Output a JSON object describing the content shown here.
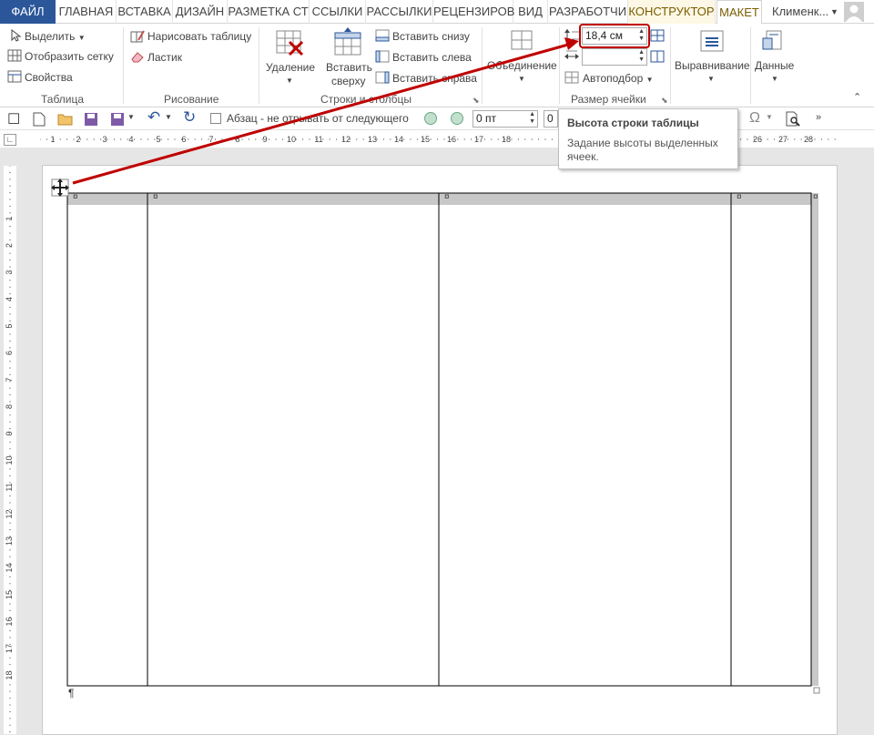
{
  "tabs": [
    {
      "label": "ФАЙЛ",
      "key": "file"
    },
    {
      "label": "ГЛАВНАЯ"
    },
    {
      "label": "ВСТАВКА"
    },
    {
      "label": "ДИЗАЙН"
    },
    {
      "label": "РАЗМЕТКА СТ"
    },
    {
      "label": "ССЫЛКИ"
    },
    {
      "label": "РАССЫЛКИ"
    },
    {
      "label": "РЕЦЕНЗИРОВ"
    },
    {
      "label": "ВИД"
    },
    {
      "label": "РАЗРАБОТЧИ"
    },
    {
      "label": "КОНСТРУКТОР",
      "key": "contextual"
    },
    {
      "label": "МАКЕТ",
      "key": "active"
    }
  ],
  "user": {
    "name": "Клименк..."
  },
  "ribbon": {
    "table_group": {
      "select": "Выделить",
      "show_grid": "Отобразить сетку",
      "properties": "Свойства",
      "label": "Таблица"
    },
    "draw_group": {
      "draw_table": "Нарисовать таблицу",
      "eraser": "Ластик",
      "label": "Рисование"
    },
    "rows_cols_group": {
      "delete": "Удаление",
      "insert_above_1": "Вставить",
      "insert_above_2": "сверху",
      "insert_below": "Вставить снизу",
      "insert_left": "Вставить слева",
      "insert_right": "Вставить справа",
      "label": "Строки и столбцы"
    },
    "merge_group": {
      "merge": "Объединение"
    },
    "cell_size_group": {
      "row_height": "18,4 см",
      "autofit": "Автоподбор",
      "label": "Размер ячейки"
    },
    "alignment": "Выравнивание",
    "data": "Данные"
  },
  "qat": {
    "keep_with_next": "Абзац - не отрывать от следующего",
    "spacing_value": "0 пт",
    "spacing_value2": "0"
  },
  "tooltip": {
    "title": "Высота строки таблицы",
    "body": "Задание высоты выделенных ячеек."
  },
  "ruler": {
    "h_marks": [
      "1",
      "2",
      "3",
      "4",
      "5",
      "6",
      "7",
      "8",
      "9",
      "10",
      "11",
      "12",
      "13",
      "14",
      "15",
      "16",
      "17",
      "18",
      "25",
      "26",
      "27",
      "28"
    ],
    "v_marks": [
      "1",
      "2",
      "3",
      "4",
      "5",
      "6",
      "7",
      "8",
      "9",
      "10",
      "11",
      "12",
      "13",
      "14",
      "15",
      "16",
      "17",
      "18"
    ]
  },
  "document": {
    "cell_marker": "¤",
    "paragraph_mark": "¶"
  },
  "colors": {
    "accent_file": "#2b579a",
    "highlight": "#c00000",
    "arrow": "#c00000"
  }
}
